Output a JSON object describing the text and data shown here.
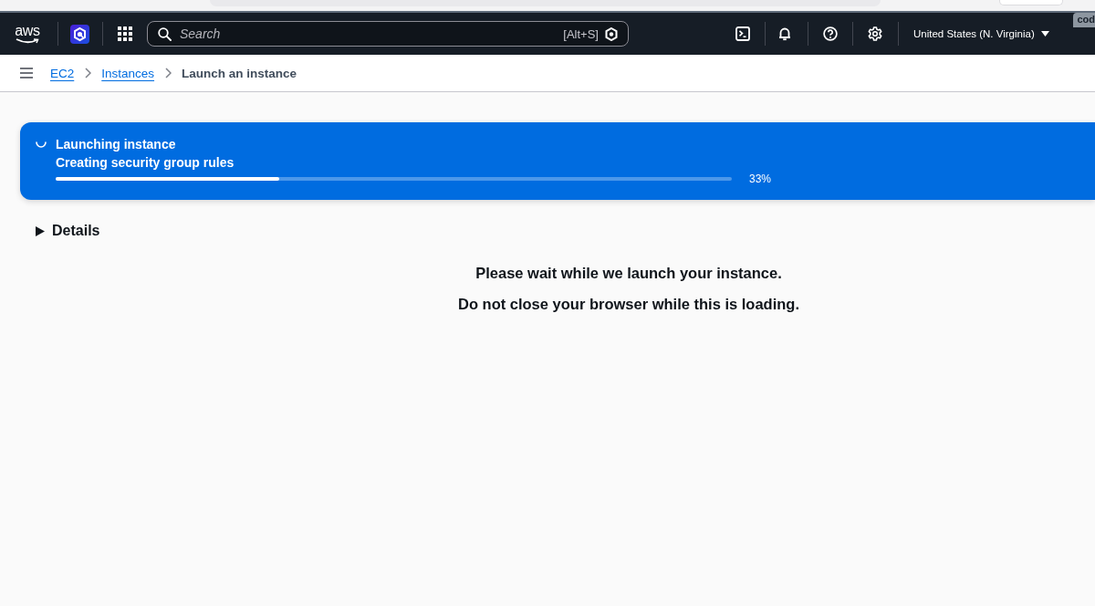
{
  "edge_tab": {
    "label": "cod"
  },
  "header": {
    "logo": "aws",
    "search": {
      "placeholder": "Search",
      "shortcut": "[Alt+S]"
    },
    "region": "United States (N. Virginia)"
  },
  "breadcrumbs": [
    {
      "label": "EC2",
      "kind": "link"
    },
    {
      "label": "Instances",
      "kind": "link"
    },
    {
      "label": "Launch an instance",
      "kind": "current"
    }
  ],
  "flashbar": {
    "title": "Launching instance",
    "message": "Creating security group rules",
    "level": 0.33,
    "reading": "33%"
  },
  "details": {
    "label": "Details",
    "expanded": false
  },
  "messages": [
    "Please wait while we launch your instance.",
    "Do not close your browser while this is loading."
  ]
}
